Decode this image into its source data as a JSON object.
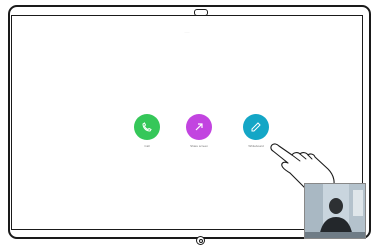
{
  "screen": {
    "title": "·····"
  },
  "actions": [
    {
      "label": "Call",
      "icon": "phone-icon",
      "color": "#35c759"
    },
    {
      "label": "Share screen",
      "icon": "share-icon",
      "color": "#c244e0"
    },
    {
      "label": "Whiteboard",
      "icon": "whiteboard-icon",
      "color": "#14a6c6"
    }
  ],
  "colors": {
    "frame": "#1a1a1a",
    "screen_bg": "#ffffff"
  }
}
